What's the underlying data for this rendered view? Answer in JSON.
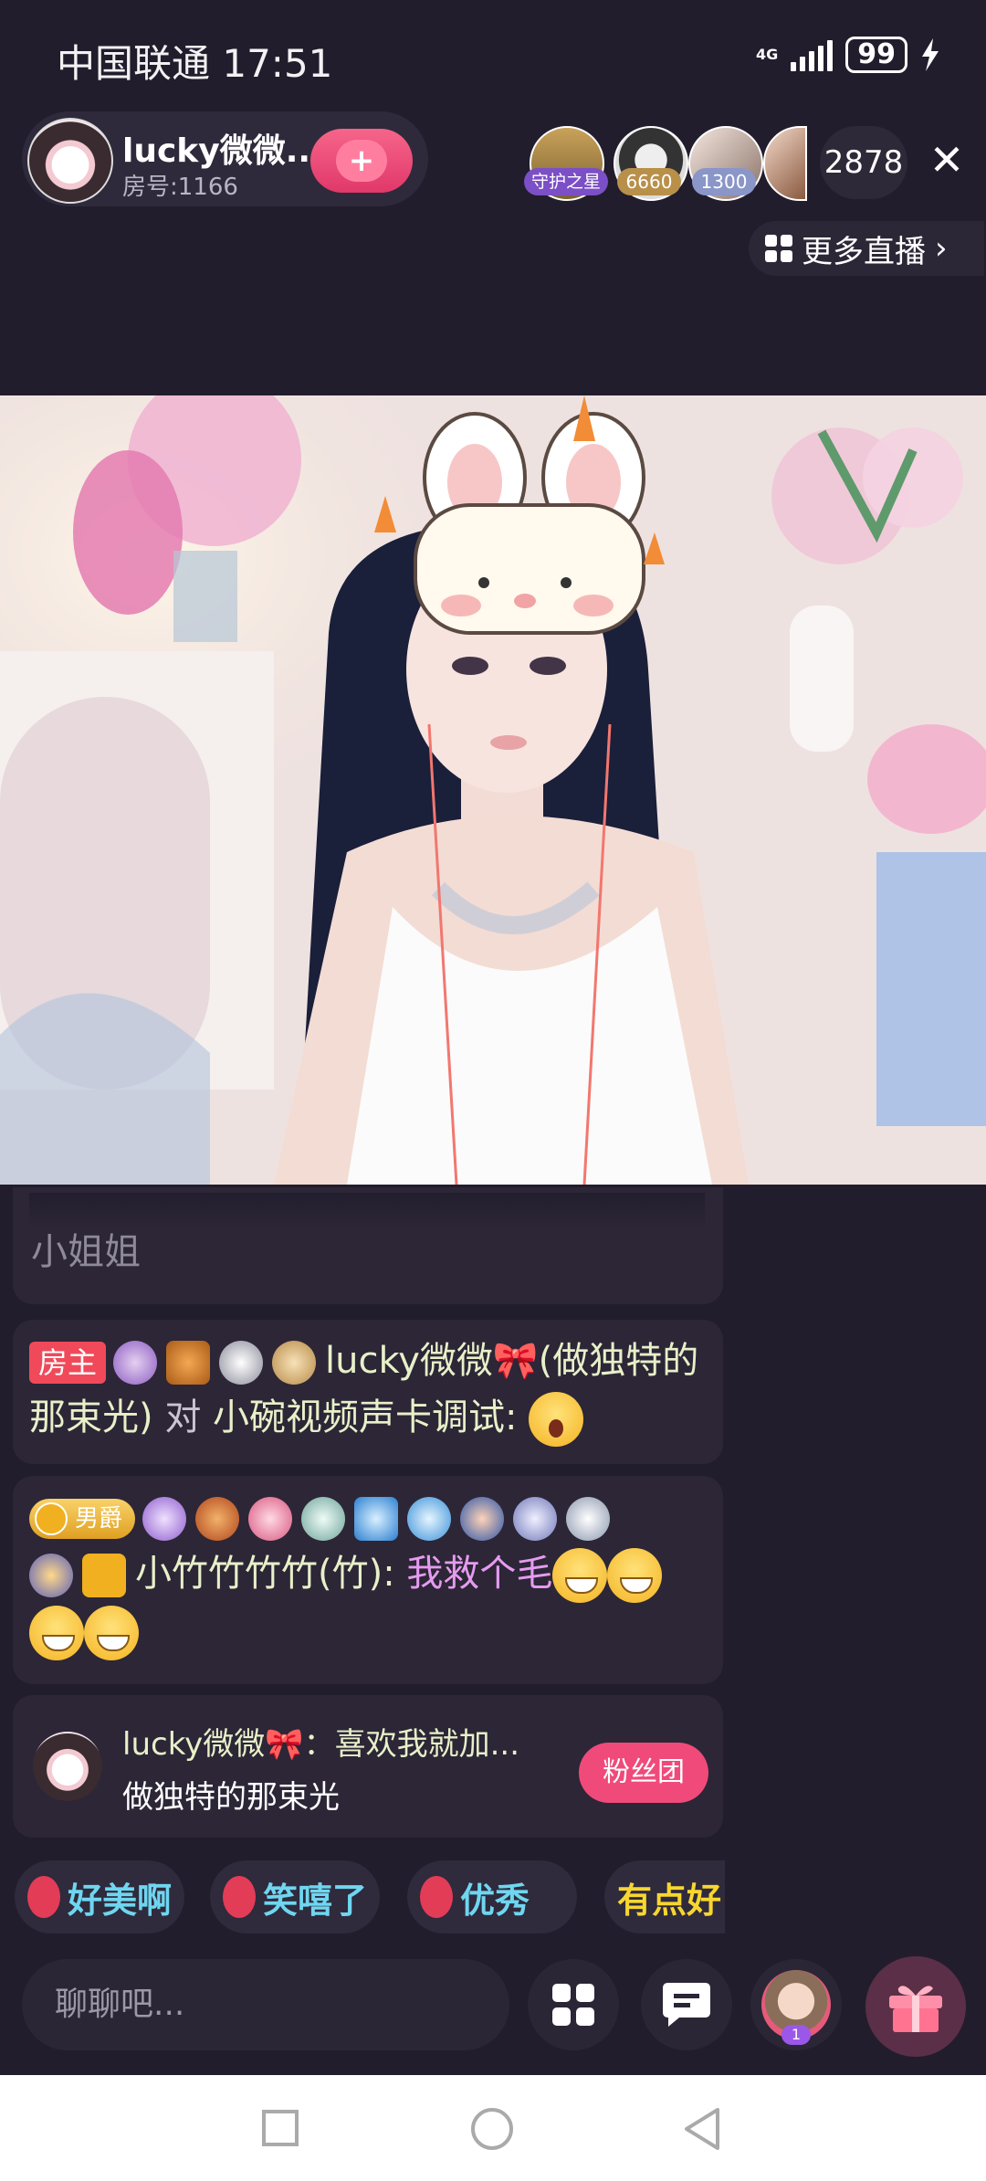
{
  "status_bar": {
    "carrier_time": "中国联通 17:51",
    "network": "4G",
    "battery": "99"
  },
  "header": {
    "host_name": "lucky微微...",
    "room_number": "房号:1166",
    "viewer_badges": [
      "守护之星",
      "6660",
      "1300"
    ],
    "viewer_count": "2878",
    "more_live_label": "更多直播"
  },
  "chat": {
    "partial_message": "小姐姐",
    "msg1": {
      "host_tag": "房主",
      "sender": "lucky微微🎀(做独特的那束光)",
      "connector": "对",
      "target": "小碗视频声卡调试:"
    },
    "msg2": {
      "rank_tag": "男爵",
      "sender": "小竹竹竹竹(竹):",
      "text": "我救个毛"
    },
    "promo": {
      "title": "lucky微微🎀：喜欢我就加...",
      "subtitle": "做独特的那束光",
      "button": "粉丝团"
    }
  },
  "quick_replies": [
    "好美啊",
    "笑嘻了",
    "优秀",
    "有点好"
  ],
  "bottom_bar": {
    "input_placeholder": "聊聊吧...",
    "avatar_badge": "1"
  },
  "colors": {
    "background": "#221d2d",
    "accent": "#f04a7a",
    "chat_text": "#e8f0c8",
    "chat_highlight": "#e59bf0"
  }
}
